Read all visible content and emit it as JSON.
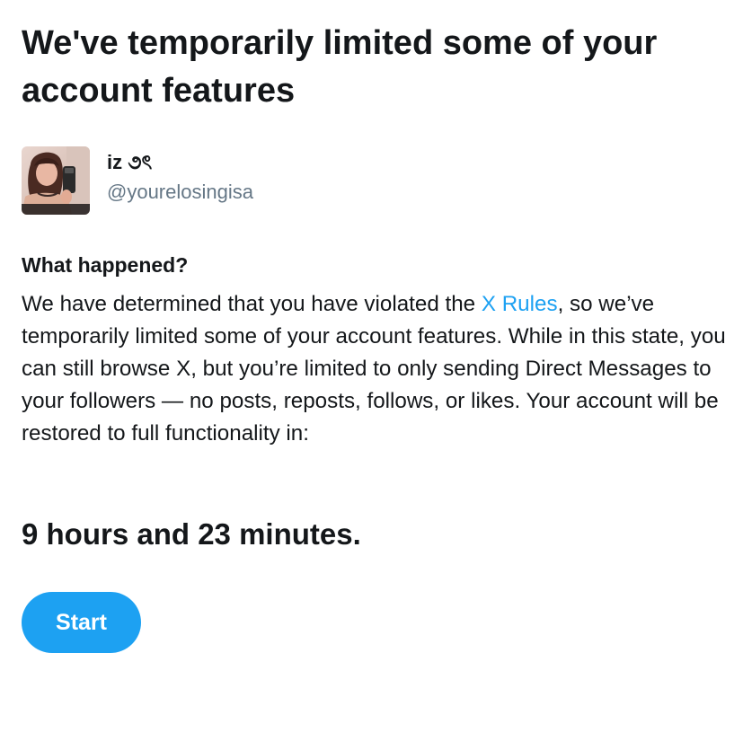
{
  "page": {
    "title": "We've temporarily limited some of your account features"
  },
  "user": {
    "display_name": "iz ૭ৎ",
    "handle": "@yourelosingisa",
    "avatar_icon": "profile-photo"
  },
  "notice": {
    "heading": "What happened?",
    "body_before_link": "We have determined that you have violated the ",
    "rules_link": "X Rules",
    "body_after_link": ", so we’ve temporarily limited some of your account features. While in this state, you can still browse X, but you’re limited to only sending Direct Messages to your followers — no posts, reposts, follows, or likes. Your account will be restored to full functionality in:",
    "countdown": "9 hours and 23 minutes."
  },
  "actions": {
    "start_label": "Start"
  },
  "colors": {
    "accent": "#1da1f2",
    "text": "#14171a",
    "muted": "#657786"
  }
}
